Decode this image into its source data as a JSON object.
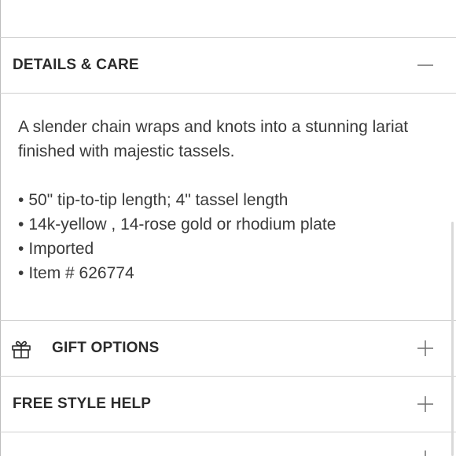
{
  "details_care": {
    "title": "DETAILS & CARE",
    "toggle_icon": "minus-icon",
    "description": "A slender chain wraps and knots into a stunning lariat finished with majestic tassels.",
    "bullets": [
      "50\" tip-to-tip length; 4\" tassel length",
      "14k-yellow , 14-rose gold or rhodium plate",
      "Imported",
      "Item # 626774"
    ]
  },
  "gift_options": {
    "title": "GIFT OPTIONS",
    "icon": "gift-icon",
    "toggle_icon": "plus-icon"
  },
  "free_style_help": {
    "title": "FREE STYLE HELP",
    "toggle_icon": "plus-icon"
  },
  "colors": {
    "text": "#2b2b2b",
    "divider": "#cfcfcf",
    "icon": "#6e6e6e"
  }
}
